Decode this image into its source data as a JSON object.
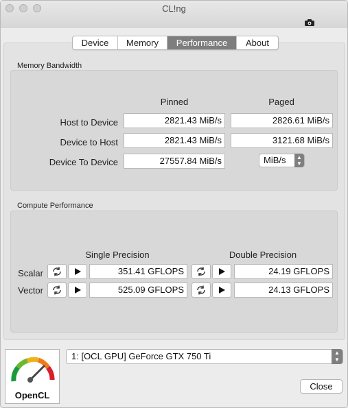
{
  "window": {
    "title": "CL!ng"
  },
  "tabs": [
    {
      "label": "Device"
    },
    {
      "label": "Memory"
    },
    {
      "label": "Performance"
    },
    {
      "label": "About"
    }
  ],
  "memory_bandwidth": {
    "section_label": "Memory Bandwidth",
    "col_pinned": "Pinned",
    "col_paged": "Paged",
    "rows": [
      {
        "label": "Host to Device",
        "pinned": "2821.43 MiB/s",
        "paged": "2826.61 MiB/s"
      },
      {
        "label": "Device to Host",
        "pinned": "2821.43 MiB/s",
        "paged": "3121.68 MiB/s"
      },
      {
        "label": "Device To Device",
        "pinned": "27557.84 MiB/s"
      }
    ],
    "unit_selected": "MiB/s"
  },
  "compute_performance": {
    "section_label": "Compute Performance",
    "col_single": "Single Precision",
    "col_double": "Double Precision",
    "rows": [
      {
        "label": "Scalar",
        "single": "351.41 GFLOPS",
        "double": "24.19 GFLOPS"
      },
      {
        "label": "Vector",
        "single": "525.09 GFLOPS",
        "double": "24.13 GFLOPS"
      }
    ]
  },
  "bottom": {
    "logo_text": "OpenCL",
    "device_selected": "1: [OCL GPU] GeForce GTX 750 Ti",
    "close_label": "Close"
  },
  "icons": {
    "refresh": "refresh-icon",
    "play": "play-icon",
    "camera": "camera-icon",
    "gauge": "gauge-icon"
  }
}
